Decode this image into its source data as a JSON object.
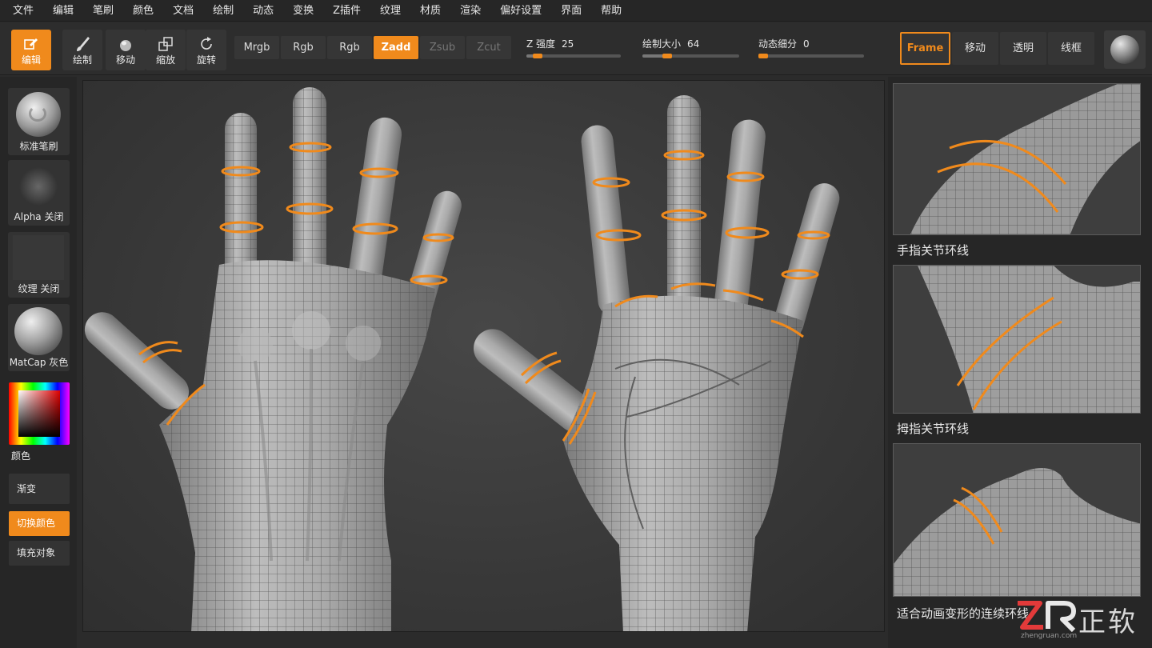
{
  "menu": [
    "文件",
    "编辑",
    "笔刷",
    "颜色",
    "文档",
    "绘制",
    "动态",
    "变换",
    "Z插件",
    "纹理",
    "材质",
    "渲染",
    "偏好设置",
    "界面",
    "帮助"
  ],
  "toolbar": {
    "tools": [
      {
        "label": "编辑",
        "icon": "edit-icon",
        "active": true
      },
      {
        "label": "绘制",
        "icon": "brush-icon",
        "active": false
      },
      {
        "label": "移动",
        "icon": "move-icon",
        "active": false
      },
      {
        "label": "缩放",
        "icon": "scale-icon",
        "active": false
      },
      {
        "label": "旋转",
        "icon": "rotate-icon",
        "active": false
      }
    ],
    "modes": [
      {
        "label": "Mrgb",
        "state": "normal"
      },
      {
        "label": "Rgb",
        "state": "normal"
      },
      {
        "label": "Rgb",
        "state": "normal"
      },
      {
        "label": "Zadd",
        "state": "active"
      },
      {
        "label": "Zsub",
        "state": "disabled"
      },
      {
        "label": "Zcut",
        "state": "disabled"
      }
    ],
    "sliders": [
      {
        "label": "Z 强度",
        "value": "25",
        "fraction": 0.12
      },
      {
        "label": "绘制大小",
        "value": "64",
        "fraction": 0.26
      },
      {
        "label": "动态细分",
        "value": "0",
        "fraction": 0.0
      }
    ],
    "view_buttons": [
      {
        "label": "Frame",
        "active": true
      },
      {
        "label": "移动",
        "active": false
      },
      {
        "label": "透明",
        "active": false
      },
      {
        "label": "线框",
        "active": false
      }
    ]
  },
  "left_panel": {
    "brush_label": "标准笔刷",
    "alpha_label": "Alpha  关闭",
    "texture_label": "纹理  关闭",
    "matcap_label": "MatCap  灰色",
    "color_label": "颜色",
    "gradient_label": "渐变",
    "switch_color_label": "切换颜色",
    "fill_object_label": "填充对象"
  },
  "right_panel": {
    "captions": [
      "手指关节环线",
      "拇指关节环线",
      "适合动画变形的连续环线"
    ]
  },
  "watermark": {
    "cn": "正软",
    "url": "zhengruan.com"
  },
  "colors": {
    "accent": "#f08a1c",
    "panel": "#262626",
    "button": "#353535"
  }
}
